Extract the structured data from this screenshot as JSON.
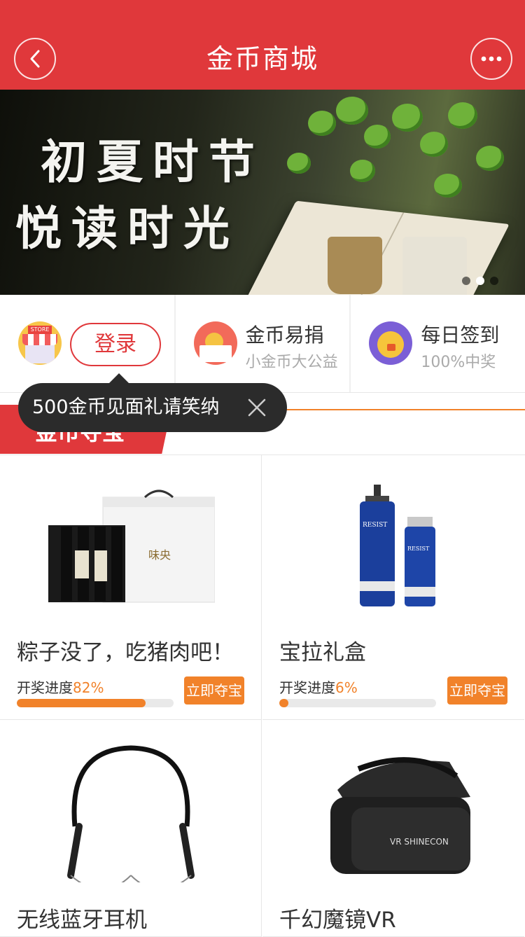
{
  "header": {
    "title": "金币商城",
    "back_icon": "chevron-left-icon",
    "more_icon": "more-dots-icon",
    "bg_color": "#e0383b"
  },
  "banner": {
    "line1": "初夏时节",
    "line2": "悦读时光",
    "slide_count": 3,
    "active_slide": 2
  },
  "features": [
    {
      "id": "store",
      "icon": "store-icon",
      "button_label": "登录"
    },
    {
      "id": "donate",
      "icon": "donate-box-icon",
      "title": "金币易捐",
      "subtitle": "小金币大公益"
    },
    {
      "id": "signin",
      "icon": "chick-icon",
      "title": "每日签到",
      "subtitle": "100%中奖"
    }
  ],
  "tooltip": {
    "text": "500金币见面礼请笑纳",
    "close_icon": "close-icon"
  },
  "section": {
    "title": "金币夺宝",
    "accent_color": "#f1822a"
  },
  "products": [
    {
      "name": "粽子没了，吃猪肉吧！",
      "progress_label": "开奖进度",
      "progress_pct": "82%",
      "progress": 0.82,
      "button": "立即夺宝"
    },
    {
      "name": "宝拉礼盒",
      "progress_label": "开奖进度",
      "progress_pct": "6%",
      "progress": 0.06,
      "button": "立即夺宝"
    },
    {
      "name": "无线蓝牙耳机"
    },
    {
      "name": "千幻魔镜VR"
    }
  ]
}
